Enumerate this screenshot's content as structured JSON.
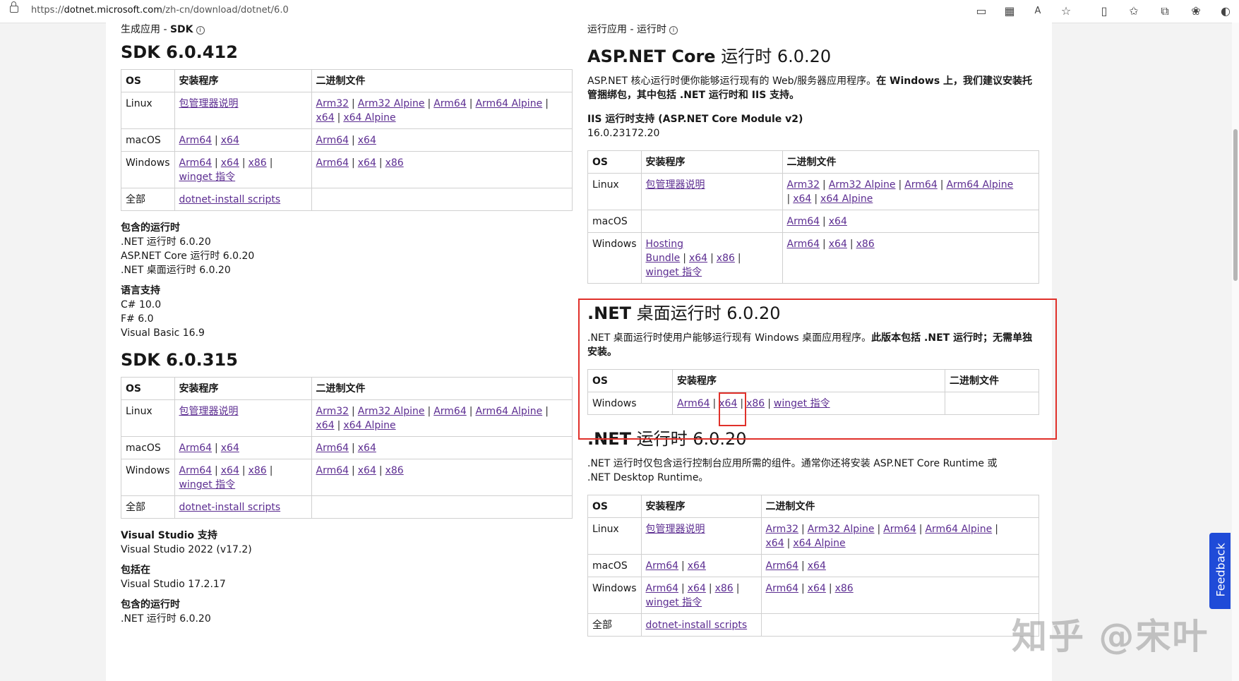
{
  "browser": {
    "url_scheme": "https://",
    "url_host": "dotnet.microsoft.com",
    "url_path": "/zh-cn/download/dotnet/6.0"
  },
  "left": {
    "section_label": "生成应用 - ",
    "section_label_bold": "SDK",
    "sdk1": {
      "title": "SDK 6.0.412",
      "headers": [
        "OS",
        "安装程序",
        "二进制文件"
      ],
      "linux": {
        "os": "Linux",
        "installer": "包管理器说明",
        "binaries": [
          "Arm32",
          "Arm32 Alpine",
          "Arm64",
          "Arm64 Alpine",
          "x64",
          "x64 Alpine"
        ]
      },
      "macos": {
        "os": "macOS",
        "installer": [
          "Arm64",
          "x64"
        ],
        "binaries": [
          "Arm64",
          "x64"
        ]
      },
      "windows": {
        "os": "Windows",
        "installer": [
          "Arm64",
          "x64",
          "x86",
          "winget 指令"
        ],
        "binaries": [
          "Arm64",
          "x64",
          "x86"
        ]
      },
      "all": {
        "os": "全部",
        "installer": "dotnet-install scripts"
      },
      "runtimes_label": "包含的运行时",
      "runtimes": [
        ".NET 运行时 6.0.20",
        "ASP.NET Core 运行时 6.0.20",
        ".NET 桌面运行时 6.0.20"
      ],
      "lang_label": "语言支持",
      "langs": [
        "C# 10.0",
        "F# 6.0",
        "Visual Basic 16.9"
      ]
    },
    "sdk2": {
      "title": "SDK 6.0.315",
      "headers": [
        "OS",
        "安装程序",
        "二进制文件"
      ],
      "linux": {
        "os": "Linux",
        "installer": "包管理器说明",
        "binaries": [
          "Arm32",
          "Arm32 Alpine",
          "Arm64",
          "Arm64 Alpine",
          "x64",
          "x64 Alpine"
        ]
      },
      "macos": {
        "os": "macOS",
        "installer": [
          "Arm64",
          "x64"
        ],
        "binaries": [
          "Arm64",
          "x64"
        ]
      },
      "windows": {
        "os": "Windows",
        "installer": [
          "Arm64",
          "x64",
          "x86",
          "winget 指令"
        ],
        "binaries": [
          "Arm64",
          "x64",
          "x86"
        ]
      },
      "all": {
        "os": "全部",
        "installer": "dotnet-install scripts"
      },
      "vs_label": "Visual Studio 支持",
      "vs_value": "Visual Studio 2022 (v17.2)",
      "incl_label": "包括在",
      "incl_value": "Visual Studio 17.2.17",
      "runtimes_label": "包含的运行时",
      "runtime_first": ".NET 运行时 6.0.20"
    }
  },
  "right": {
    "section_label": "运行应用 - 运行时",
    "aspnet": {
      "title_bold": "ASP.NET Core",
      "title_rest": " 运行时 6.0.20",
      "desc1": "ASP.NET 核心运行时便你能够运行现有的 Web/服务器应用程序。",
      "desc_bold": "在 Windows 上，我们建议安装托管捆绑包，其中包括 .NET 运行时和 IIS 支持。",
      "iis_label": "IIS 运行时支持 (ASP.NET Core Module v2)",
      "iis_value": "16.0.23172.20",
      "headers": [
        "OS",
        "安装程序",
        "二进制文件"
      ],
      "linux": {
        "os": "Linux",
        "installer": "包管理器说明",
        "binaries": [
          "Arm32",
          "Arm32 Alpine",
          "Arm64",
          "Arm64 Alpine",
          "x64",
          "x64 Alpine"
        ]
      },
      "macos": {
        "os": "macOS",
        "binaries": [
          "Arm64",
          "x64"
        ]
      },
      "windows": {
        "os": "Windows",
        "installer": [
          "Hosting Bundle",
          "x64",
          "x86",
          "winget 指令"
        ],
        "binaries": [
          "Arm64",
          "x64",
          "x86"
        ]
      }
    },
    "desktop": {
      "title_bold": ".NET",
      "title_rest": " 桌面运行时 6.0.20",
      "desc1": ".NET 桌面运行时使用户能够运行现有 Windows 桌面应用程序。",
      "desc_bold": "此版本包括 .NET 运行时；无需单独安装。",
      "headers": [
        "OS",
        "安装程序",
        "二进制文件"
      ],
      "windows": {
        "os": "Windows",
        "installer": [
          "Arm64",
          "x64",
          "x86",
          "winget 指令"
        ]
      }
    },
    "runtime": {
      "title_bold": ".NET",
      "title_rest": " 运行时 6.0.20",
      "desc": ".NET 运行时仅包含运行控制台应用所需的组件。通常你还将安装 ASP.NET Core Runtime 或 .NET Desktop Runtime。",
      "headers": [
        "OS",
        "安装程序",
        "二进制文件"
      ],
      "linux": {
        "os": "Linux",
        "installer": "包管理器说明",
        "binaries": [
          "Arm32",
          "Arm32 Alpine",
          "Arm64",
          "Arm64 Alpine",
          "x64",
          "x64 Alpine"
        ]
      },
      "macos": {
        "os": "macOS",
        "installer": [
          "Arm64",
          "x64"
        ],
        "binaries": [
          "Arm64",
          "x64"
        ]
      },
      "windows": {
        "os": "Windows",
        "installer": [
          "Arm64",
          "x64",
          "x86",
          "winget 指令"
        ],
        "binaries": [
          "Arm64",
          "x64",
          "x86"
        ]
      },
      "all": {
        "os": "全部",
        "installer": "dotnet-install scripts"
      }
    }
  },
  "feedback_label": "Feedback",
  "watermark": "知乎 @宋叶",
  "colors": {
    "link": "#5c2d91",
    "highlight": "#e0302a",
    "feedback": "#1f4bd8"
  }
}
